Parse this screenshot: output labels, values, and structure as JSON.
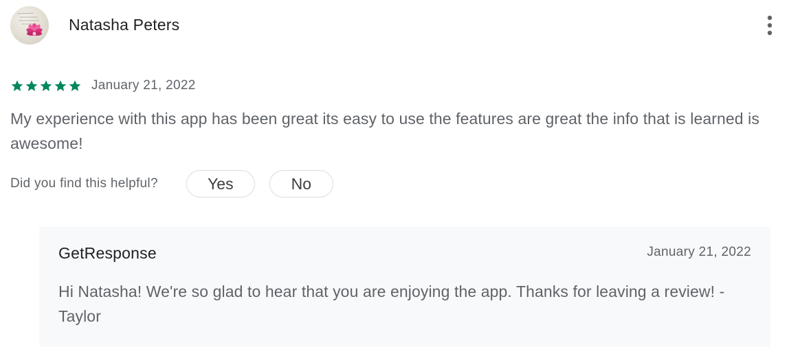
{
  "review": {
    "author": {
      "name": "Natasha Peters",
      "avatar_icon": "user-avatar-pink-lotus"
    },
    "more_icon": "more-vert-icon",
    "rating": {
      "stars_filled": 5,
      "stars_total": 5,
      "star_icon": "star-icon",
      "color": "#01875f"
    },
    "date": "January 21, 2022",
    "text": "My experience with this app has been great its easy to use the features are great the info that is learned is awesome!",
    "helpful": {
      "prompt": "Did you find this helpful?",
      "yes_label": "Yes",
      "no_label": "No"
    }
  },
  "reply": {
    "author": "GetResponse",
    "date": "January 21, 2022",
    "text": "Hi Natasha! We're so glad to hear that you are enjoying the app. Thanks for leaving a review! -Taylor",
    "background": "#f8f9fa"
  }
}
